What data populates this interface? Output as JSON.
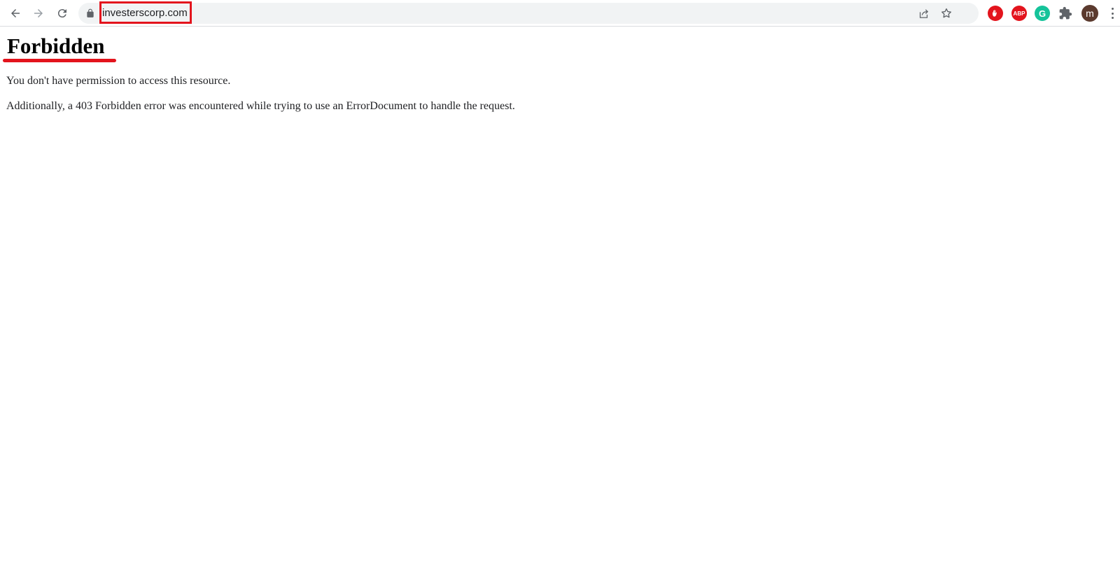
{
  "browser": {
    "url": "investerscorp.com",
    "profile_initial": "m",
    "extensions": [
      {
        "name": "adblock-icon",
        "color": "#e3141d"
      },
      {
        "name": "adblock-plus-icon",
        "label": "ABP",
        "color": "#e3141d"
      },
      {
        "name": "grammarly-icon",
        "label": "G",
        "color": "#15c39a"
      }
    ],
    "accent_highlight": "#e3141d"
  },
  "page": {
    "title": "Forbidden",
    "message": "You don't have permission to access this resource.",
    "detail": "Additionally, a 403 Forbidden error was encountered while trying to use an ErrorDocument to handle the request."
  }
}
